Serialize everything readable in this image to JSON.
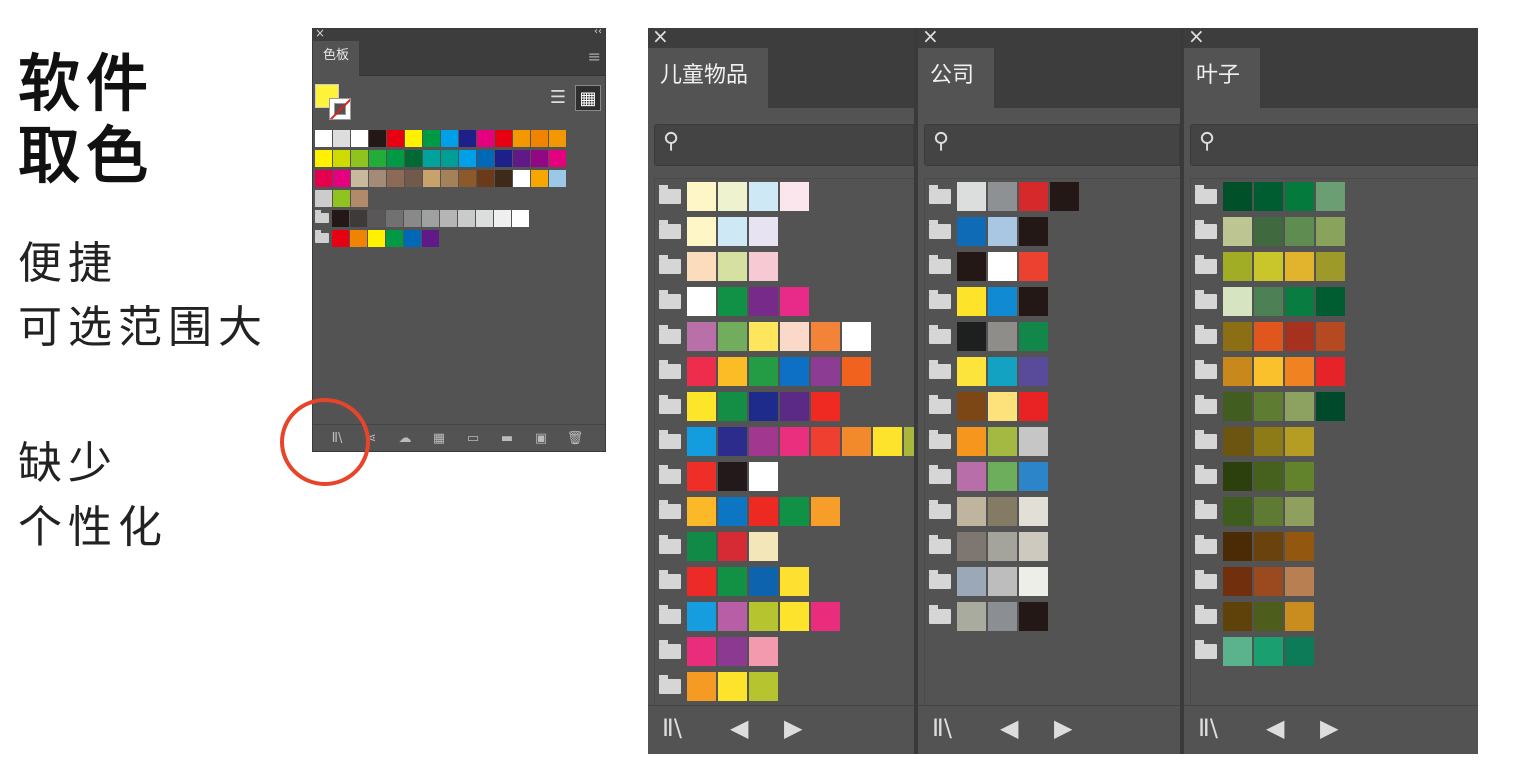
{
  "caption": {
    "title_line1": "软件",
    "title_line2": "取色",
    "pros_line1": "便捷",
    "pros_line2": "可选范围大",
    "cons_line1": "缺少",
    "cons_line2": "个性化"
  },
  "swatches_panel": {
    "close_glyph": "×",
    "collapse_glyph": "‹‹",
    "tab_label": "色板",
    "menu_glyph": "≡",
    "list_view_glyph": "☰",
    "grid_view_glyph": "▦",
    "rows": [
      {
        "folder": false,
        "colors": [
          "#ffffff",
          "#dddddd",
          "#ffffff",
          "#231815",
          "#e60012",
          "#fff100",
          "#009944",
          "#00a0e9",
          "#1d2088",
          "#e4007f",
          "#e60012",
          "#f39800",
          "#f08300",
          "#f39800"
        ]
      },
      {
        "folder": false,
        "colors": [
          "#fff100",
          "#cfdb00",
          "#8fc31f",
          "#22ac38",
          "#009944",
          "#006934",
          "#00a29a",
          "#009e96",
          "#00a0e9",
          "#0068b7",
          "#1d2088",
          "#601986",
          "#920783",
          "#e4007f"
        ]
      },
      {
        "folder": false,
        "colors": [
          "#e5004f",
          "#e4007f",
          "#c9b99c",
          "#a48b78",
          "#8c6a55",
          "#71594b",
          "#c7a36b",
          "#a3825a",
          "#8b5a2b",
          "#6b3a18",
          "#3e2a1b",
          "#ffffff",
          "#f6a800",
          "#9cc8e8"
        ]
      },
      {
        "folder": false,
        "colors": [
          "#cccccc",
          "#8fc31f",
          "#b08a6a"
        ]
      },
      {
        "folder": true,
        "colors": [
          "#231815",
          "#3e3a39",
          "#595757",
          "#727171",
          "#898989",
          "#9fa0a0",
          "#b5b5b6",
          "#c9caca",
          "#dcdddd",
          "#efefef",
          "#ffffff"
        ]
      },
      {
        "folder": true,
        "colors": [
          "#e60012",
          "#f08300",
          "#fff100",
          "#009944",
          "#0068b7",
          "#601986"
        ]
      }
    ],
    "bottom_icons": [
      "Ⅱ\\",
      "⋖",
      "☁",
      "▦",
      "▭",
      "▬",
      "▣",
      "🗑"
    ]
  },
  "libraries": [
    {
      "tab_label": "儿童物品",
      "close_glyph": "×",
      "search_icon_glyph": "⚲",
      "groups": [
        [
          "#fff6c8",
          "#eef2cf",
          "#cfe8f5",
          "#fce6ee"
        ],
        [
          "#fff6c8",
          "#cfe8f5",
          "#e7e3f3"
        ],
        [
          "#fbdcbd",
          "#d6e0a0",
          "#f7c9d3"
        ],
        [
          "#ffffff",
          "#109145",
          "#772a8a",
          "#e82b89"
        ],
        [
          "#b96fa8",
          "#71ad5d",
          "#fde55c",
          "#fbd9c9",
          "#f38339",
          "#ffffff"
        ],
        [
          "#ee2c4b",
          "#fbbc26",
          "#239c45",
          "#0d70c4",
          "#8c3c93",
          "#f1621f"
        ],
        [
          "#fde52a",
          "#138e44",
          "#1e2b8b",
          "#5b2a86",
          "#ee2a23"
        ],
        [
          "#139ddf",
          "#2c2c8c",
          "#a1378f",
          "#e92f7e",
          "#ef3f31",
          "#f2892b",
          "#fde32c",
          "#a9b83a"
        ],
        [
          "#ef2e27",
          "#24191a",
          "#ffffff"
        ],
        [
          "#fbb929",
          "#0d76c2",
          "#ec2a22",
          "#109145",
          "#f79e28"
        ],
        [
          "#128a47",
          "#d62a35",
          "#f3e6b9"
        ],
        [
          "#ec2a27",
          "#129145",
          "#0d63ad",
          "#fde030"
        ],
        [
          "#159ddf",
          "#b85ea6",
          "#b6c42f",
          "#fde32c",
          "#e92d7c"
        ],
        [
          "#e92d7c",
          "#8c3a91",
          "#f39aae"
        ],
        [
          "#f59a23",
          "#fde32c",
          "#b6c42f"
        ]
      ],
      "footer_lib_glyph": "Ⅱ\\",
      "footer_prev_glyph": "◀",
      "footer_next_glyph": "▶"
    },
    {
      "tab_label": "公司",
      "close_glyph": "×",
      "search_icon_glyph": "⚲",
      "groups": [
        [
          "#dcdddd",
          "#8e9193",
          "#d6292c",
          "#231815"
        ],
        [
          "#0f6bb5",
          "#a9c6e2",
          "#231815"
        ],
        [
          "#231815",
          "#ffffff",
          "#ec4131"
        ],
        [
          "#fde42a",
          "#118ad4",
          "#231815"
        ],
        [
          "#1e1f1f",
          "#8e8d8a",
          "#12874a"
        ],
        [
          "#fde43d",
          "#13a2c1",
          "#5a4a9a"
        ],
        [
          "#7d4615",
          "#fde27b",
          "#e92224"
        ],
        [
          "#f6961c",
          "#a3b941",
          "#c6c6c6"
        ],
        [
          "#b76ea9",
          "#6cae5c",
          "#2c85c8"
        ],
        [
          "#bfb59e",
          "#847b65",
          "#e2e0d6"
        ],
        [
          "#7e7771",
          "#a5a49c",
          "#cdc9bf"
        ],
        [
          "#9aa8b7",
          "#bdbdbd",
          "#eceee7"
        ],
        [
          "#a8ab9d",
          "#8b8e93",
          "#231815"
        ]
      ],
      "footer_lib_glyph": "Ⅱ\\",
      "footer_prev_glyph": "◀",
      "footer_next_glyph": "▶"
    },
    {
      "tab_label": "叶子",
      "close_glyph": "×",
      "search_icon_glyph": "⚲",
      "groups": [
        [
          "#00502a",
          "#005c31",
          "#047a3c",
          "#6b9e72"
        ],
        [
          "#bdc593",
          "#41693f",
          "#5f8c50",
          "#89a35c"
        ],
        [
          "#a0ad25",
          "#c8c62b",
          "#e2b42e",
          "#9e9a2a"
        ],
        [
          "#d7e4c1",
          "#4d8055",
          "#097c42",
          "#005c31"
        ],
        [
          "#8c6e14",
          "#e0561c",
          "#a7311f",
          "#b54a22"
        ],
        [
          "#c8881c",
          "#fbc12d",
          "#f18221",
          "#e62328"
        ],
        [
          "#415d1f",
          "#5f7c33",
          "#8da261",
          "#00492a"
        ],
        [
          "#6c5511",
          "#8d7b17",
          "#b59c22"
        ],
        [
          "#2b400d",
          "#45611d",
          "#62832b"
        ],
        [
          "#3e5c1d",
          "#5f7a33",
          "#8f9f5d"
        ],
        [
          "#4a2b06",
          "#6a420e",
          "#93570f"
        ],
        [
          "#722f0d",
          "#9b4a1f",
          "#b77f52"
        ],
        [
          "#5e420a",
          "#4d5e1c",
          "#c88c1f"
        ],
        [
          "#5bb38e",
          "#1aa070",
          "#0e7b58"
        ]
      ],
      "footer_lib_glyph": "Ⅱ\\",
      "footer_prev_glyph": "◀",
      "footer_next_glyph": "▶"
    }
  ],
  "colors": {
    "panel_bg": "#535353",
    "panel_dark": "#3d3d3d",
    "highlight_circle": "#e8442a"
  }
}
